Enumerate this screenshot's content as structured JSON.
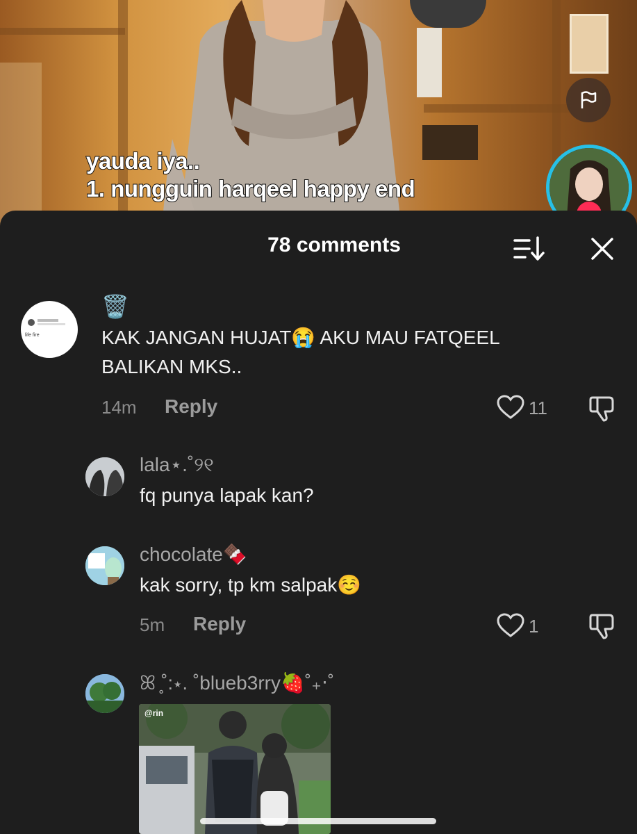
{
  "video": {
    "caption_line1": "yauda iya..",
    "caption_line2": "1. nungguin harqeel happy end"
  },
  "comments_panel": {
    "title": "78 comments"
  },
  "comments": [
    {
      "username": "🗑️",
      "text": "KAK JANGAN HUJAT😭 AKU MAU FATQEEL BALIKAN MKS..",
      "avatar_caption": "life fire",
      "time": "14m",
      "reply_label": "Reply",
      "likes": "11"
    },
    {
      "username": "lala⋆.˚୨୧",
      "text": "fq punya lapak kan?"
    },
    {
      "username": "chocolate🍫",
      "text": "kak sorry, tp km salpak☺️",
      "time": "5m",
      "reply_label": "Reply",
      "likes": "1"
    },
    {
      "username": "ꕤ ̥˚:⋆. ˚blueb3rry🍓˚₊‧˚",
      "attachment_watermark": "@rin"
    }
  ],
  "colors": {
    "sheet_bg": "#1e1e1e",
    "live_ring": "#27c0e6",
    "live_badge": "#fe2c55"
  },
  "icons": [
    "flag-icon",
    "sort-icon",
    "close-icon",
    "heart-icon",
    "dislike-icon"
  ]
}
